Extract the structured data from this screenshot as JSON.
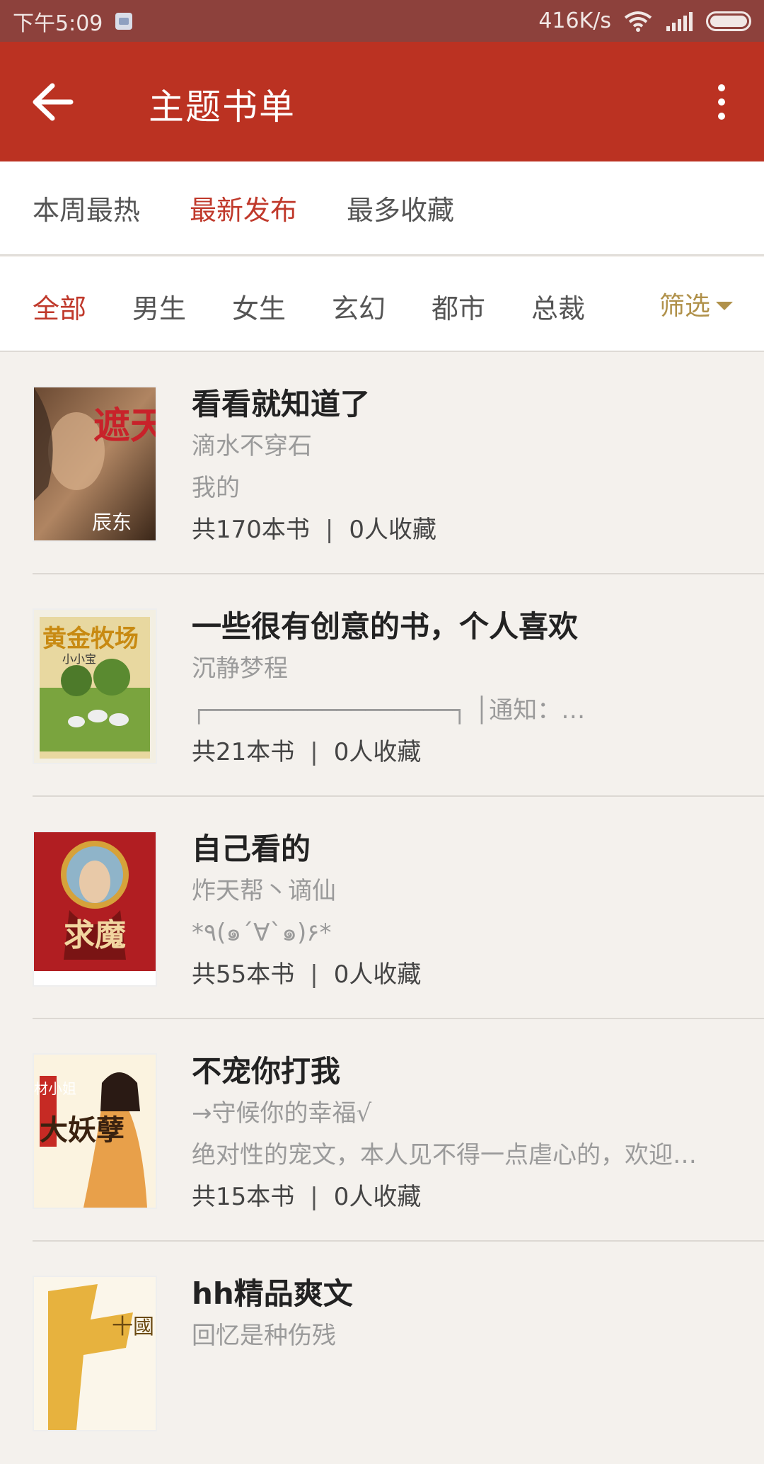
{
  "status_bar": {
    "time": "下午5:09",
    "net_speed": "416K/s"
  },
  "app_bar": {
    "title": "主题书单"
  },
  "sort_tabs": [
    {
      "label": "本周最热",
      "active": false
    },
    {
      "label": "最新发布",
      "active": true
    },
    {
      "label": "最多收藏",
      "active": false
    }
  ],
  "categories": [
    {
      "label": "全部",
      "active": true
    },
    {
      "label": "男生",
      "active": false
    },
    {
      "label": "女生",
      "active": false
    },
    {
      "label": "玄幻",
      "active": false
    },
    {
      "label": "都市",
      "active": false
    },
    {
      "label": "总裁",
      "active": false
    }
  ],
  "filter_label": "筛选",
  "book_lists": [
    {
      "title": "看看就知道了",
      "author": "滴水不穿石",
      "desc": "我的",
      "books": "共170本书",
      "favorites": "0人收藏",
      "cover_text": "遮天",
      "cover_sub": "辰东"
    },
    {
      "title": "一些很有创意的书，个人喜欢",
      "author": "沉静梦程",
      "desc": "┌─────────────────┐       │通知：…",
      "books": "共21本书",
      "favorites": "0人收藏",
      "cover_text": "黄金牧场",
      "cover_sub": "小小宝"
    },
    {
      "title": "自己看的",
      "author": "炸天帮丶谪仙",
      "desc": "*٩(๑´∀`๑)۶*",
      "books": "共55本书",
      "favorites": "0人收藏",
      "cover_text": "求魔",
      "cover_sub": ""
    },
    {
      "title": "不宠你打我",
      "author": "→守候你的幸福√",
      "desc": "绝对性的宠文，本人见不得一点虐心的，欢迎…",
      "books": "共15本书",
      "favorites": "0人收藏",
      "cover_text": "大妖孽",
      "cover_sub": "废材小姐"
    },
    {
      "title": "hh精品爽文",
      "author": "回忆是种伤残",
      "desc": "",
      "books": "",
      "favorites": "",
      "cover_text": "十國",
      "cover_sub": ""
    }
  ],
  "colors": {
    "status_bar": "#8d413c",
    "app_bar": "#bb3222",
    "accent": "#c0392b",
    "filter": "#b0914a"
  }
}
